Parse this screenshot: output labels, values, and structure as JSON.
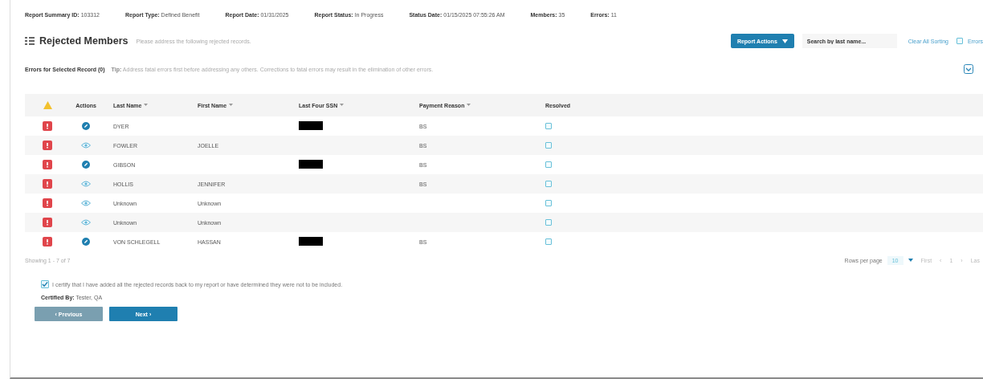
{
  "summary": [
    {
      "label": "Report Summary ID:",
      "value": "103312"
    },
    {
      "label": "Report Type:",
      "value": "Defined Benefit"
    },
    {
      "label": "Report Date:",
      "value": "01/31/2025"
    },
    {
      "label": "Report Status:",
      "value": "In Progress"
    },
    {
      "label": "Status Date:",
      "value": "01/15/2025 07:55:26 AM"
    },
    {
      "label": "Members:",
      "value": "35"
    },
    {
      "label": "Errors:",
      "value": "11"
    }
  ],
  "title": "Rejected Members",
  "subtitle": "Please address the following rejected records.",
  "report_actions": "Report Actions",
  "search": {
    "placeholder": "Search by last name..."
  },
  "clear_sorting": "Clear All Sorting",
  "errors_only": {
    "label": "Errors",
    "checked": false
  },
  "errors_heading": "Errors for Selected Record (0)",
  "tip_label": "Tip:",
  "tip": "Address fatal errors first before addressing any others. Corrections to fatal errors may result in the elimination of other errors.",
  "columns": [
    {
      "label": "Actions",
      "sortable": false
    },
    {
      "label": "Last Name",
      "sortable": true
    },
    {
      "label": "First Name",
      "sortable": true
    },
    {
      "label": "Last Four SSN",
      "sortable": true
    },
    {
      "label": "Payment Reason",
      "sortable": true
    },
    {
      "label": "Resolved",
      "sortable": false
    }
  ],
  "rows": [
    {
      "kind": "edit",
      "last": "DYER",
      "first": "",
      "ssn_redacted": true,
      "reason": "BS",
      "resolved": false
    },
    {
      "kind": "view",
      "last": "FOWLER",
      "first": "JOELLE",
      "ssn_redacted": false,
      "reason": "BS",
      "resolved": false
    },
    {
      "kind": "edit",
      "last": "GIBSON",
      "first": "",
      "ssn_redacted": true,
      "reason": "BS",
      "resolved": false
    },
    {
      "kind": "view",
      "last": "HOLLIS",
      "first": "JENNIFER",
      "ssn_redacted": false,
      "reason": "BS",
      "resolved": false
    },
    {
      "kind": "view",
      "last": "Unknown",
      "first": "Unknown",
      "ssn_redacted": false,
      "reason": "",
      "resolved": false
    },
    {
      "kind": "view",
      "last": "Unknown",
      "first": "Unknown",
      "ssn_redacted": false,
      "reason": "",
      "resolved": false
    },
    {
      "kind": "edit",
      "last": "VON SCHLEGELL",
      "first": "HASSAN",
      "ssn_redacted": true,
      "reason": "BS",
      "resolved": false
    }
  ],
  "showing": "Showing 1 - 7 of 7",
  "rows_per_page_label": "Rows per page",
  "rows_per_page": "10",
  "pager": [
    "First",
    "‹",
    "1",
    "›",
    "Las"
  ],
  "certify": {
    "text": "I certify that I have added all the rejected records back to my report or have determined they were not to be included.",
    "checked": true
  },
  "certified_by_label": "Certified By:",
  "certified_by": "Tester, QA",
  "buttons": [
    {
      "label": "‹ Previous",
      "kind": "secondary"
    },
    {
      "label": "Next ›",
      "kind": "primary"
    }
  ]
}
